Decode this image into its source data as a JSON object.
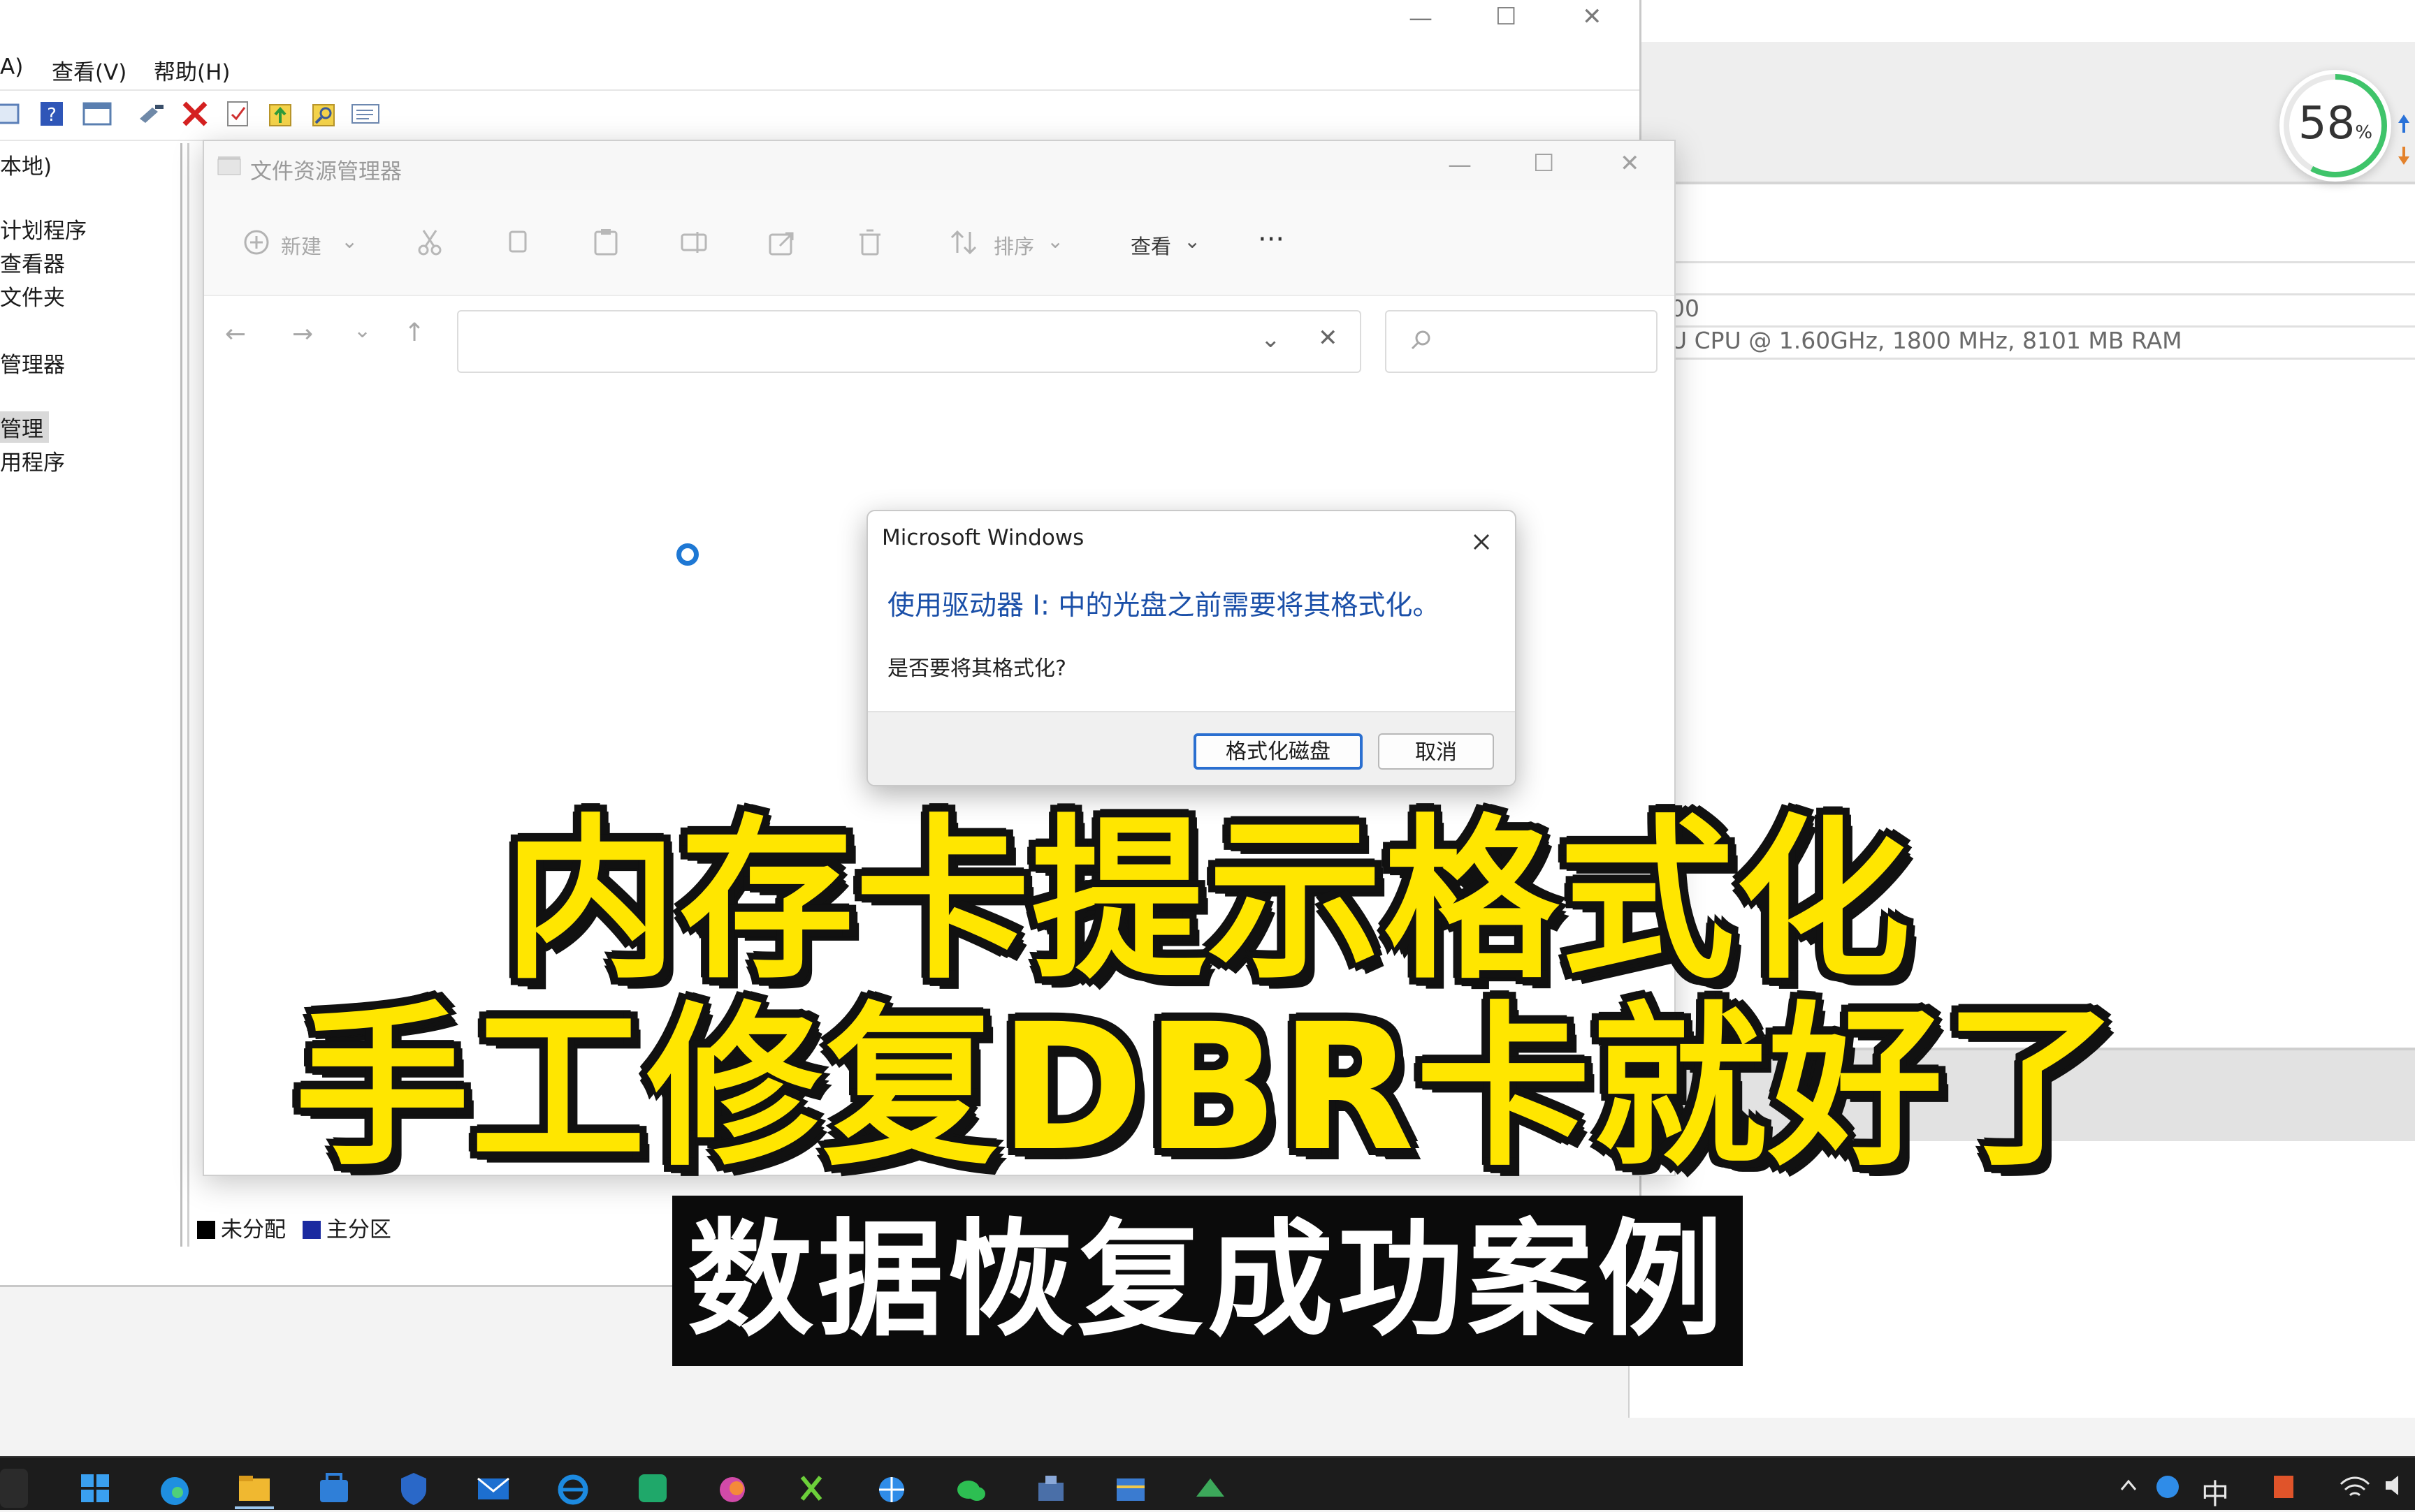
{
  "background_mgmt": {
    "menu": [
      "A)",
      "查看(V)",
      "帮助(H)"
    ],
    "tree_items": [
      "本地)",
      "计划程序",
      "查看器",
      "文件夹",
      "管理器",
      "管理",
      "用程序"
    ],
    "legend": {
      "unallocated": "未分配",
      "primary": "主分区"
    }
  },
  "background_info": {
    "line1": "00",
    "line2": "U CPU @ 1.60GHz, 1800 MHz, 8101 MB RAM",
    "perf_badge": {
      "value": "58",
      "unit": "%"
    }
  },
  "explorer": {
    "title": "文件资源管理器",
    "commands": {
      "new": "新建",
      "sort": "排序",
      "view": "查看"
    }
  },
  "dialog": {
    "title": "Microsoft Windows",
    "message": "使用驱动器 I: 中的光盘之前需要将其格式化。",
    "question": "是否要将其格式化?",
    "format_button": "格式化磁盘",
    "cancel_button": "取消"
  },
  "caption": {
    "line1": "内存卡提示格式化",
    "line2": "手工修复DBR卡就好了",
    "subtitle": "数据恢复成功案例"
  },
  "taskbar": {
    "tray_text": "中"
  },
  "colors": {
    "caption_yellow": "#ffe600",
    "caption_outline": "#111111",
    "dialog_accent": "#2a6fd0",
    "dialog_message": "#1a4fa8",
    "legend_unallocated": "#000000",
    "legend_primary": "#1a2aa0"
  }
}
